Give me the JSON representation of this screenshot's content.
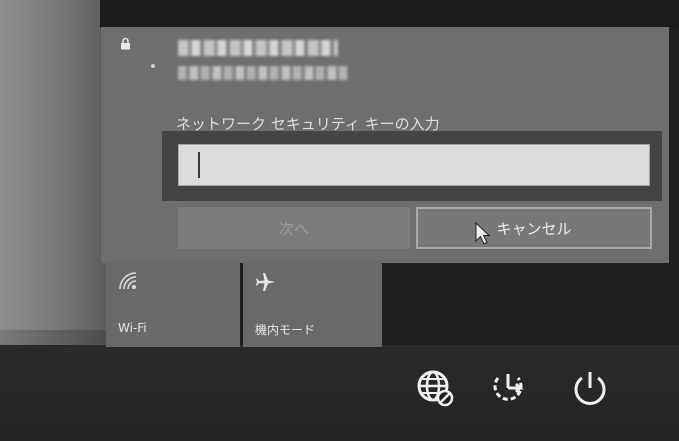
{
  "flyout": {
    "key_label": "ネットワーク セキュリティ キーの入力",
    "input_value": "",
    "next_label": "次へ",
    "cancel_label": "キャンセル"
  },
  "tiles": [
    {
      "label": "Wi-Fi",
      "icon": "wifi-icon"
    },
    {
      "label": "機内モード",
      "icon": "airplane-icon"
    }
  ],
  "system_icons": [
    "globe-network-icon",
    "sleep-icon",
    "power-icon"
  ],
  "colors": {
    "panel": "#6e6e6e",
    "input": "#dcdcdc",
    "tile": "#696969",
    "background": "#1f1f1f"
  }
}
